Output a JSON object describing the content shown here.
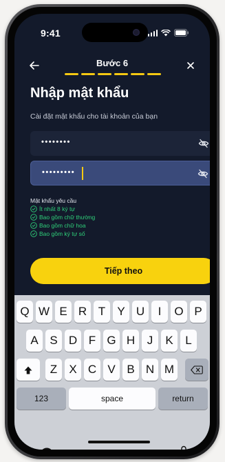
{
  "status_bar": {
    "time": "9:41"
  },
  "nav": {
    "step_title": "Bước 6",
    "progress_segments": 6,
    "back_icon": "arrow-left-icon",
    "close_icon": "close-icon"
  },
  "page": {
    "title": "Nhập mật khẩu",
    "subtitle": "Cài đặt mật khẩu cho tài khoản của bạn"
  },
  "fields": {
    "password": "••••••••",
    "confirm_password": "•••••••••"
  },
  "requirements": {
    "title": "Mật khẩu yêu cầu",
    "items": [
      "Ít nhất 8 ký tự",
      "Bao gồm chữ thường",
      "Bao gồm chữ hoa",
      "Bao gồm ký tự số"
    ]
  },
  "continue_label": "Tiếp theo",
  "keyboard": {
    "row1": [
      "Q",
      "W",
      "E",
      "R",
      "T",
      "Y",
      "U",
      "I",
      "O",
      "P"
    ],
    "row2": [
      "A",
      "S",
      "D",
      "F",
      "G",
      "H",
      "J",
      "K",
      "L"
    ],
    "row3": [
      "Z",
      "X",
      "C",
      "V",
      "B",
      "N",
      "M"
    ],
    "numbers_label": "123",
    "space_label": "space",
    "return_label": "return"
  },
  "colors": {
    "background": "#131a2b",
    "accent": "#f8d20e",
    "success": "#2fd07a",
    "active_field": "#3a4a7a"
  }
}
